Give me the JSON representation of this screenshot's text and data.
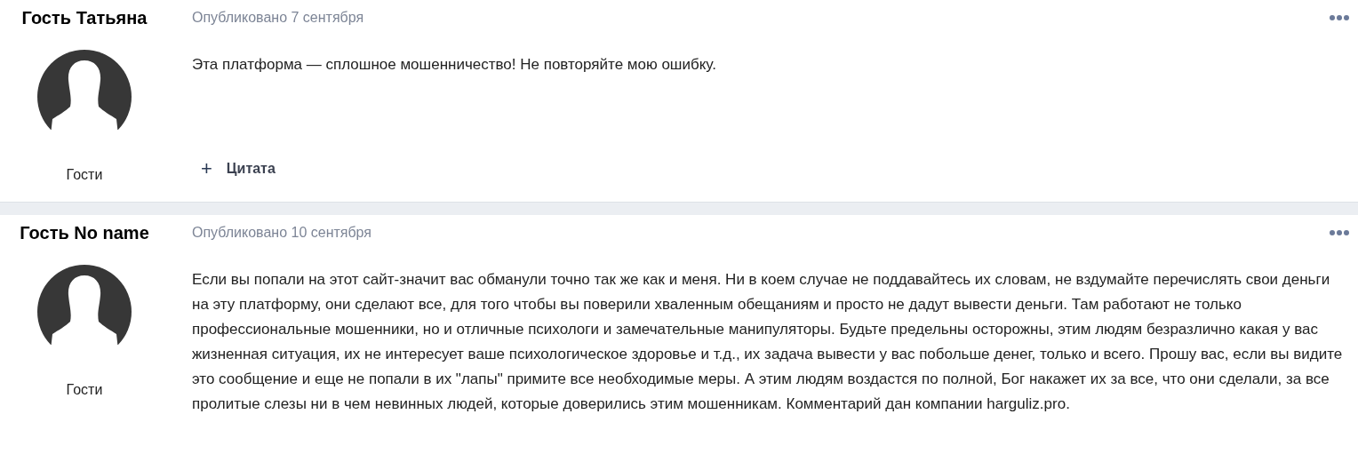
{
  "posts": [
    {
      "author": "Гость Татьяна",
      "role": "Гости",
      "published": "Опубликовано 7 сентября",
      "text": "Эта платформа — сплошное мошенничество! Не повторяйте мою ошибку.",
      "quote_icon": "+",
      "quote_label": "Цитата"
    },
    {
      "author": "Гость No name",
      "role": "Гости",
      "published": "Опубликовано 10 сентября",
      "text": "Если вы попали на этот сайт-значит вас обманули точно так же как и меня. Ни в коем случае не поддавайтесь их словам, не вздумайте перечислять свои деньги на эту платформу, они сделают все, для того чтобы вы поверили хваленным обещаниям и просто не дадут вывести деньги. Там работают не только профессиональные мошенники, но и отличные психологи и замечательные манипуляторы. Будьте предельны осторожны, этим людям безразлично какая у вас жизненная ситуация, их не интересует ваше психологическое здоровье и т.д., их задача вывести у вас побольше денег, только и всего. Прошу вас, если вы видите это сообщение и еще не попали в их \"лапы\" примите все необходимые меры. А этим людям воздастся по полной, Бог накажет их за все, что они сделали, за все пролитые слезы ни в чем невинных людей, которые доверились этим мошенникам. Комментарий дан компании harguliz.pro."
    }
  ]
}
